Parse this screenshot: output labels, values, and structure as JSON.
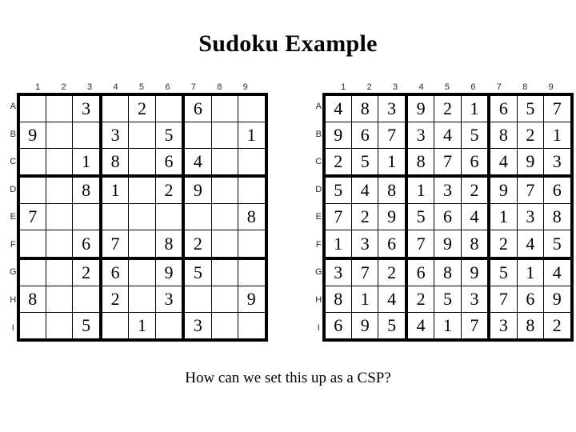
{
  "slide": {
    "title": "Sudoku Example",
    "caption": "How can we set this up as a CSP?"
  },
  "grids": {
    "column_headers": [
      "1",
      "2",
      "3",
      "4",
      "5",
      "6",
      "7",
      "8",
      "9"
    ],
    "row_headers": [
      "A",
      "B",
      "C",
      "D",
      "E",
      "F",
      "G",
      "H",
      "I"
    ],
    "puzzle": {
      "label": "Sudoku puzzle with given clues",
      "rows": [
        [
          "",
          "",
          "3",
          "",
          "2",
          "",
          "6",
          "",
          ""
        ],
        [
          "9",
          "",
          "",
          "3",
          "",
          "5",
          "",
          "",
          "1"
        ],
        [
          "",
          "",
          "1",
          "8",
          "",
          "6",
          "4",
          "",
          ""
        ],
        [
          "",
          "",
          "8",
          "1",
          "",
          "2",
          "9",
          "",
          ""
        ],
        [
          "7",
          "",
          "",
          "",
          "",
          "",
          "",
          "",
          "8"
        ],
        [
          "",
          "",
          "6",
          "7",
          "",
          "8",
          "2",
          "",
          ""
        ],
        [
          "",
          "",
          "2",
          "6",
          "",
          "9",
          "5",
          "",
          ""
        ],
        [
          "8",
          "",
          "",
          "2",
          "",
          "3",
          "",
          "",
          "9"
        ],
        [
          "",
          "",
          "5",
          "",
          "1",
          "",
          "3",
          "",
          ""
        ]
      ]
    },
    "solution": {
      "label": "Completed sudoku solution",
      "rows": [
        [
          "4",
          "8",
          "3",
          "9",
          "2",
          "1",
          "6",
          "5",
          "7"
        ],
        [
          "9",
          "6",
          "7",
          "3",
          "4",
          "5",
          "8",
          "2",
          "1"
        ],
        [
          "2",
          "5",
          "1",
          "8",
          "7",
          "6",
          "4",
          "9",
          "3"
        ],
        [
          "5",
          "4",
          "8",
          "1",
          "3",
          "2",
          "9",
          "7",
          "6"
        ],
        [
          "7",
          "2",
          "9",
          "5",
          "6",
          "4",
          "1",
          "3",
          "8"
        ],
        [
          "1",
          "3",
          "6",
          "7",
          "9",
          "8",
          "2",
          "4",
          "5"
        ],
        [
          "3",
          "7",
          "2",
          "6",
          "8",
          "9",
          "5",
          "1",
          "4"
        ],
        [
          "8",
          "1",
          "4",
          "2",
          "5",
          "3",
          "7",
          "6",
          "9"
        ],
        [
          "6",
          "9",
          "5",
          "4",
          "1",
          "7",
          "3",
          "8",
          "2"
        ]
      ]
    }
  },
  "colors": {
    "ink": "#000000",
    "label": "#2b2b2b",
    "background": "#ffffff"
  }
}
